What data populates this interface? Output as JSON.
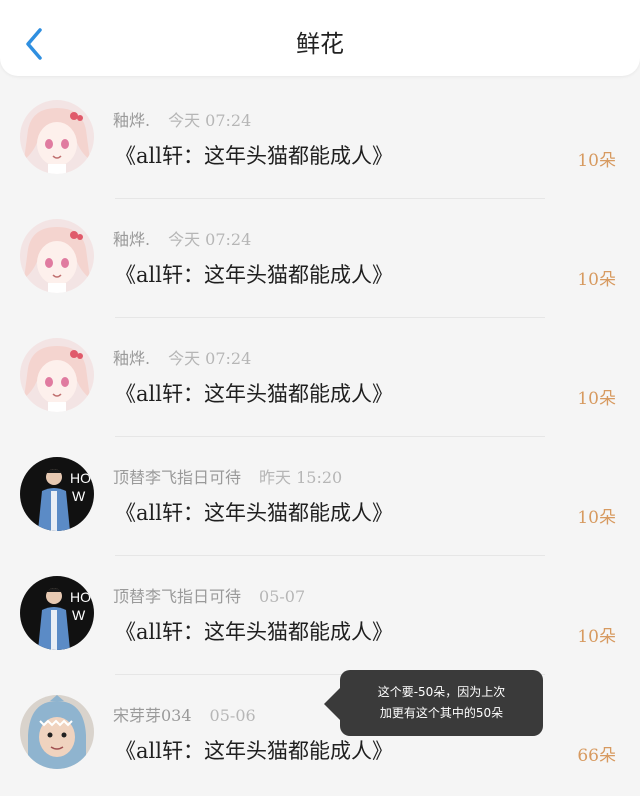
{
  "header": {
    "title": "鲜花"
  },
  "rows": [
    {
      "user": "釉烨.",
      "date": "今天 07:24",
      "title": "《all轩：这年头猫都能成人》",
      "count": "10朵",
      "avatar": "anime-girl"
    },
    {
      "user": "釉烨.",
      "date": "今天 07:24",
      "title": "《all轩：这年头猫都能成人》",
      "count": "10朵",
      "avatar": "anime-girl"
    },
    {
      "user": "釉烨.",
      "date": "今天 07:24",
      "title": "《all轩：这年头猫都能成人》",
      "count": "10朵",
      "avatar": "anime-girl"
    },
    {
      "user": "顶替李飞指日可待",
      "date": "昨天 15:20",
      "title": "《all轩：这年头猫都能成人》",
      "count": "10朵",
      "avatar": "person-dark"
    },
    {
      "user": "顶替李飞指日可待",
      "date": "05-07",
      "title": "《all轩：这年头猫都能成人》",
      "count": "10朵",
      "avatar": "person-dark"
    },
    {
      "user": "宋芽芽034",
      "date": "05-06",
      "title": "《all轩：这年头猫都能成人》",
      "count": "66朵",
      "avatar": "child-shark"
    }
  ],
  "tooltip": {
    "line1": "这个要-50朵，因为上次",
    "line2": "加更有这个其中的50朵"
  }
}
